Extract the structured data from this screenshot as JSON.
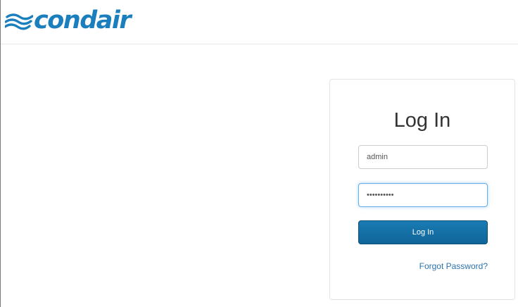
{
  "brand": {
    "logo_text": "condair",
    "logo_icon": "wave-lines-icon",
    "logo_color": "#1b7fbe"
  },
  "login_card": {
    "title": "Log In",
    "username": {
      "value": "admin"
    },
    "password": {
      "value": "••••••••••"
    },
    "submit_label": "Log In",
    "forgot_label": "Forgot Password?"
  },
  "colors": {
    "primary_button": "#1570a6",
    "link": "#2d73aa",
    "focus_border": "#66afe9"
  }
}
